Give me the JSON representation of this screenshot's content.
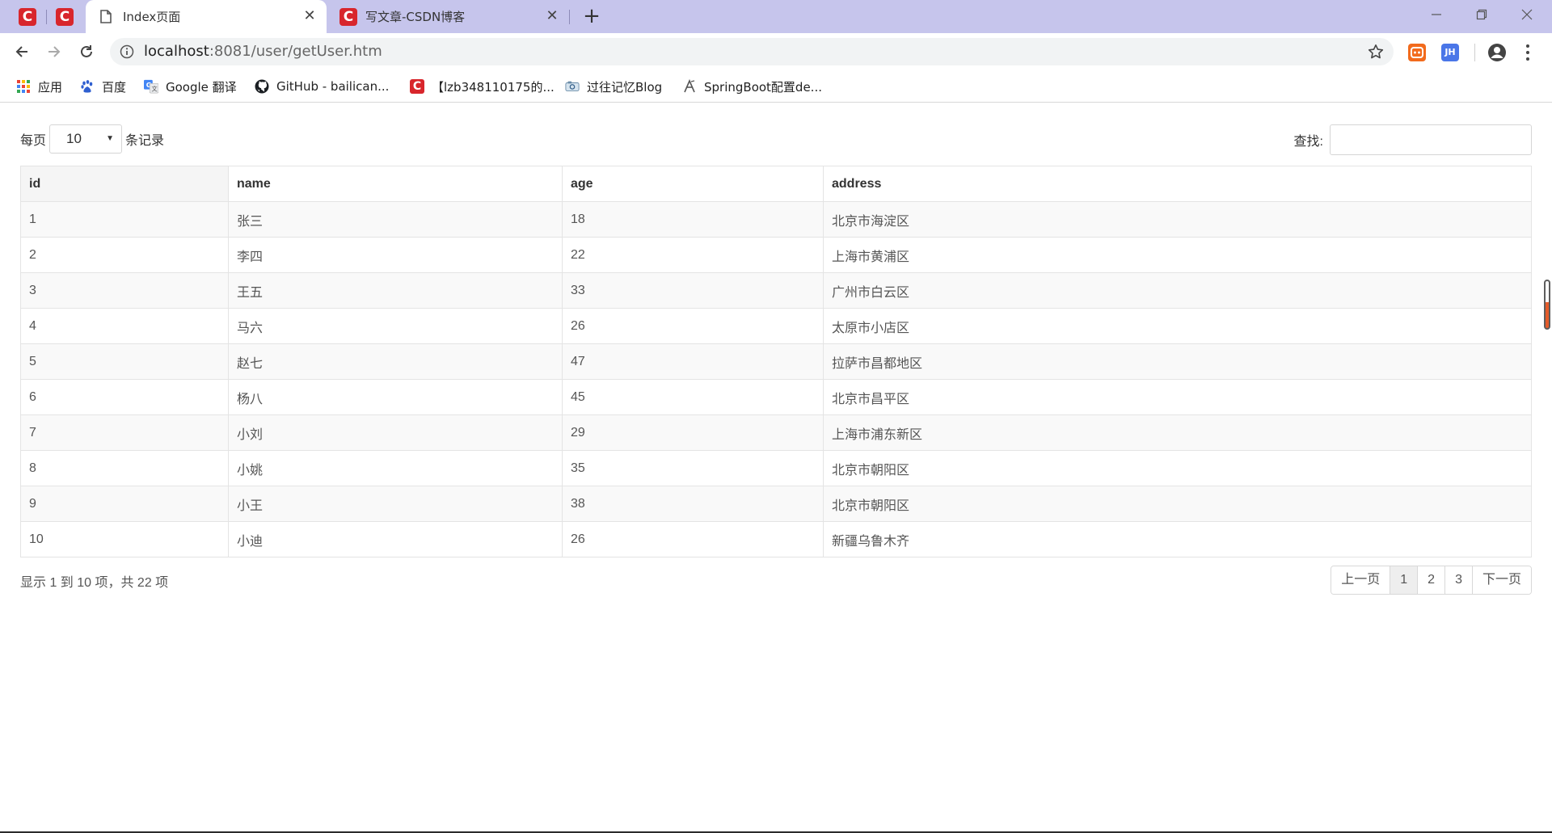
{
  "browser": {
    "tabs": [
      {
        "title": "Index页面",
        "favicon": "page-icon",
        "active": true
      },
      {
        "title": "写文章-CSDN博客",
        "favicon": "csdn-icon",
        "active": false
      }
    ],
    "pinned_tab_icon": "C",
    "address": {
      "host": "localhost",
      "path": ":8081/user/getUser.htm"
    },
    "extensions": [
      {
        "label": "",
        "color": "#f26b1d"
      },
      {
        "label": "JH",
        "color": "#4a76e8"
      }
    ],
    "bookmarks": [
      {
        "label": "应用",
        "icon": "apps-grid-icon"
      },
      {
        "label": "百度",
        "icon": "baidu-paw-icon"
      },
      {
        "label": "Google 翻译",
        "icon": "google-translate-icon"
      },
      {
        "label": "GitHub - bailican...",
        "icon": "github-icon"
      },
      {
        "label": "【lzb348110175的...",
        "icon": "csdn-icon"
      },
      {
        "label": "过往记忆Blog",
        "icon": "blog-icon"
      },
      {
        "label": "SpringBoot配置de...",
        "icon": "spring-icon"
      }
    ]
  },
  "page": {
    "length": {
      "prefix": "每页",
      "selected": "10",
      "suffix": "条记录"
    },
    "search": {
      "label": "查找:",
      "value": ""
    },
    "table": {
      "columns": [
        "id",
        "name",
        "age",
        "address"
      ],
      "rows": [
        [
          "1",
          "张三",
          "18",
          "北京市海淀区"
        ],
        [
          "2",
          "李四",
          "22",
          "上海市黄浦区"
        ],
        [
          "3",
          "王五",
          "33",
          "广州市白云区"
        ],
        [
          "4",
          "马六",
          "26",
          "太原市小店区"
        ],
        [
          "5",
          "赵七",
          "47",
          "拉萨市昌都地区"
        ],
        [
          "6",
          "杨八",
          "45",
          "北京市昌平区"
        ],
        [
          "7",
          "小刘",
          "29",
          "上海市浦东新区"
        ],
        [
          "8",
          "小姚",
          "35",
          "北京市朝阳区"
        ],
        [
          "9",
          "小王",
          "38",
          "北京市朝阳区"
        ],
        [
          "10",
          "小迪",
          "26",
          "新疆乌鲁木齐"
        ]
      ]
    },
    "info": "显示 1 到 10 项，共 22 项",
    "pagination": {
      "prev": "上一页",
      "pages": [
        "1",
        "2",
        "3"
      ],
      "current": "1",
      "next": "下一页"
    }
  }
}
